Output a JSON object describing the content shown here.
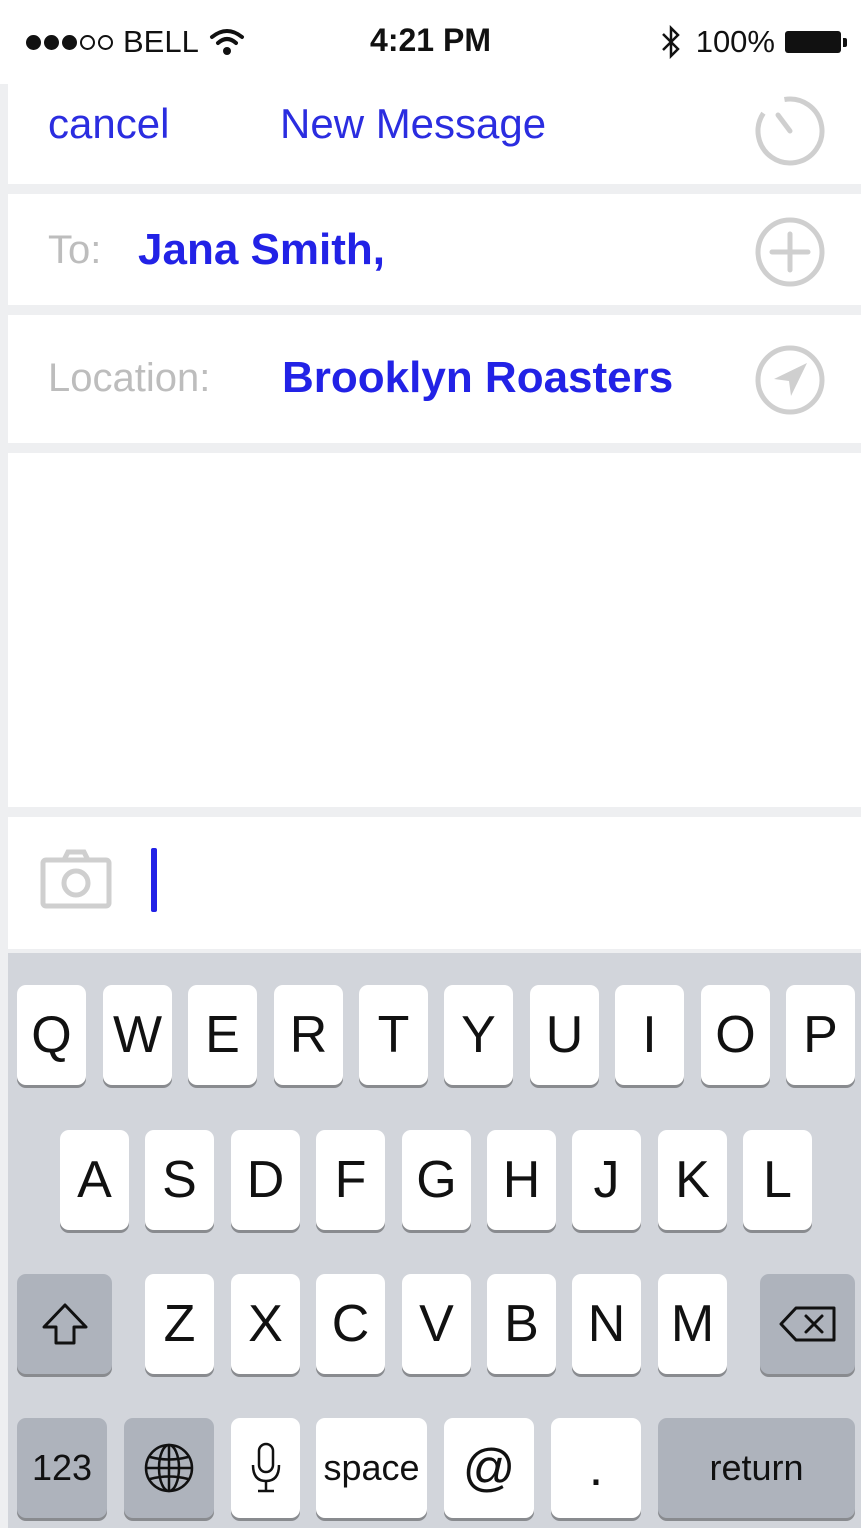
{
  "status_bar": {
    "carrier": "BELL",
    "time": "4:21 PM",
    "battery": "100%",
    "signal_bars_filled": 3,
    "signal_bars_total": 5
  },
  "nav": {
    "cancel_label": "cancel",
    "title": "New Message",
    "timer_icon": "timer-icon"
  },
  "to_field": {
    "label": "To:",
    "value": "Jana Smith,",
    "add_icon": "plus-circle-icon"
  },
  "location_field": {
    "label": "Location:",
    "value": "Brooklyn Roasters",
    "icon": "location-arrow-icon"
  },
  "compose": {
    "camera_icon": "camera-icon"
  },
  "keyboard": {
    "row1": [
      "Q",
      "W",
      "E",
      "R",
      "T",
      "Y",
      "U",
      "I",
      "O",
      "P"
    ],
    "row2": [
      "A",
      "S",
      "D",
      "F",
      "G",
      "H",
      "J",
      "K",
      "L"
    ],
    "row3": [
      "Z",
      "X",
      "C",
      "V",
      "B",
      "N",
      "M"
    ],
    "numbers_label": "123",
    "space_label": "space",
    "at_label": "@",
    "period_label": ".",
    "return_label": "return"
  },
  "colors": {
    "accent": "#2b2de0",
    "label_gray": "#bdbdbd",
    "keyboard_bg": "#d2d5db"
  }
}
